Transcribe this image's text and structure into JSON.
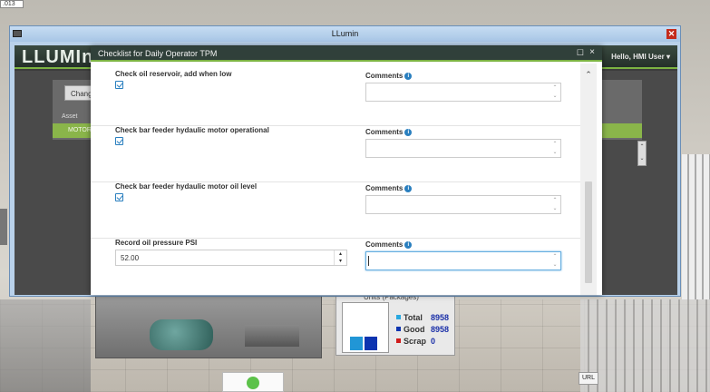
{
  "background": {
    "top_field": ".013",
    "units_widget": {
      "header": "Units (Packages)",
      "legend": [
        {
          "label": "Total",
          "value": "8958",
          "color": "#29a8e0"
        },
        {
          "label": "Good",
          "value": "8958",
          "color": "#0d34b0"
        },
        {
          "label": "Scrap",
          "value": "0",
          "color": "#d01c1c"
        }
      ]
    },
    "url_button": "URL"
  },
  "window": {
    "title": "LLumin",
    "close_glyph": "✕"
  },
  "llumin": {
    "logo": "LLUMIn",
    "user_menu": "Hello, HMI User ▾",
    "change_button": "Chang",
    "asset_label": "Asset",
    "row_text": "MOTOR",
    "spin_glyphs": [
      "⌃",
      "⌄"
    ]
  },
  "modal": {
    "title": "Checklist for Daily Operator TPM",
    "maximize_glyph": "☐",
    "close_glyph": "×",
    "comments_label": "Comments",
    "info_glyph": "i",
    "items": [
      {
        "question": "Check oil reservoir, add when low",
        "checked": true
      },
      {
        "question": "Check bar feeder hydaulic motor operational",
        "checked": true
      },
      {
        "question": "Check bar feeder hydaulic motor oil level",
        "checked": true
      },
      {
        "question": "Record oil pressure PSI",
        "value": "52.00"
      }
    ],
    "scroll_up_glyph": "⌃",
    "arrow_up": "⌃",
    "arrow_down": "⌄",
    "spin_up": "▴",
    "spin_down": "▾"
  },
  "colors": {
    "accent_green": "#7cb342",
    "header_dark": "#30403a",
    "info_blue": "#2a7fbf"
  }
}
